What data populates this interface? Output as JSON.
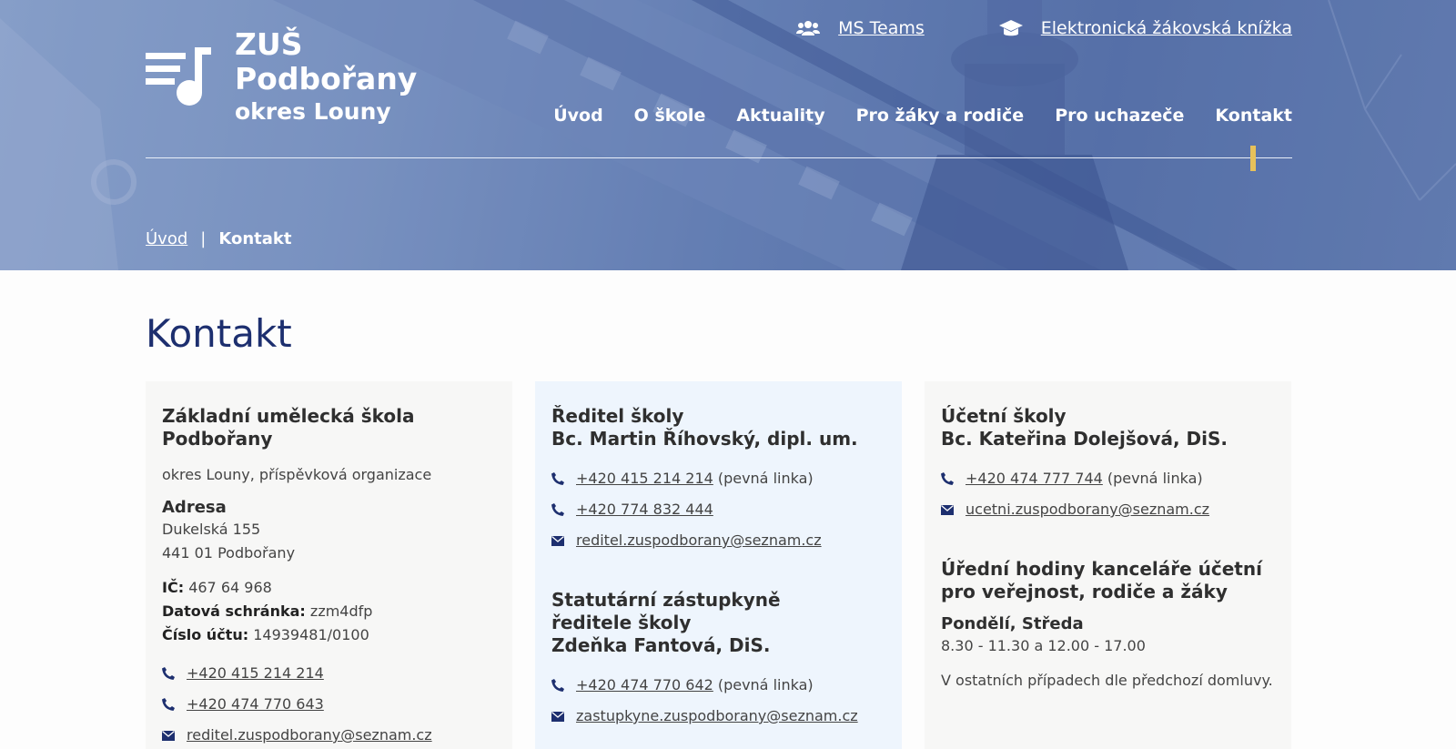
{
  "brand": {
    "line1": "ZUŠ",
    "line2": "Podbořany",
    "line3": "okres Louny"
  },
  "top_links": [
    {
      "label": "MS Teams",
      "icon": "users-icon"
    },
    {
      "label": "Elektronická žákovská knížka",
      "icon": "graduation-cap-icon"
    }
  ],
  "nav": [
    "Úvod",
    "O škole",
    "Aktuality",
    "Pro žáky a rodiče",
    "Pro uchazeče",
    "Kontakt"
  ],
  "active_nav": "Kontakt",
  "breadcrumb": {
    "home": "Úvod",
    "separator": "|",
    "current": "Kontakt"
  },
  "page_title": "Kontakt",
  "card1": {
    "title": "Základní umělecká škola Podbořany",
    "subtitle": "okres Louny, příspěvková organizace",
    "address_label": "Adresa",
    "address_line1": "Dukelská 155",
    "address_line2": "441 01 Podbořany",
    "ic_label": "IČ:",
    "ic_value": "467 64 968",
    "ds_label": "Datová schránka:",
    "ds_value": "zzm4dfp",
    "account_label": "Číslo účtu:",
    "account_value": "14939481/0100",
    "phone1": "+420 415 214 214",
    "phone2": "+420 474 770 643",
    "email": "reditel.zuspodborany@seznam.cz"
  },
  "card2": {
    "title_line1": "Ředitel školy",
    "title_line2": "Bc. Martin Říhovský, dipl. um.",
    "phone1": "+420 415 214 214",
    "phone1_note": "(pevná linka)",
    "phone2": "+420 774 832 444",
    "email": "reditel.zuspodborany@seznam.cz",
    "deputy_line1": "Statutární zástupkyně",
    "deputy_line2": "ředitele školy",
    "deputy_line3": "Zdeňka Fantová, DiS.",
    "deputy_phone": "+420 474 770 642",
    "deputy_phone_note": "(pevná linka)",
    "deputy_email": "zastupkyne.zuspodborany@seznam.cz"
  },
  "card3": {
    "title_line1": "Účetní školy",
    "title_line2": "Bc. Kateřina Dolejšová, DiS.",
    "phone": "+420 474 777 744",
    "phone_note": "(pevná linka)",
    "email": "ucetni.zuspodborany@seznam.cz",
    "hours_title": "Úřední hodiny kanceláře účetní pro veřejnost, rodiče a žáky",
    "hours_days": "Pondělí, Středa",
    "hours_times": "8.30 - 11.30 a 12.00 - 17.00",
    "hours_note": "V ostatních případech dle předchozí domluvy."
  },
  "colors": {
    "title_blue": "#1d2f6f",
    "accent_yellow": "#e7c15a",
    "icon_blue": "#1d2f6f",
    "card_alt_bg": "#eef5fd"
  }
}
